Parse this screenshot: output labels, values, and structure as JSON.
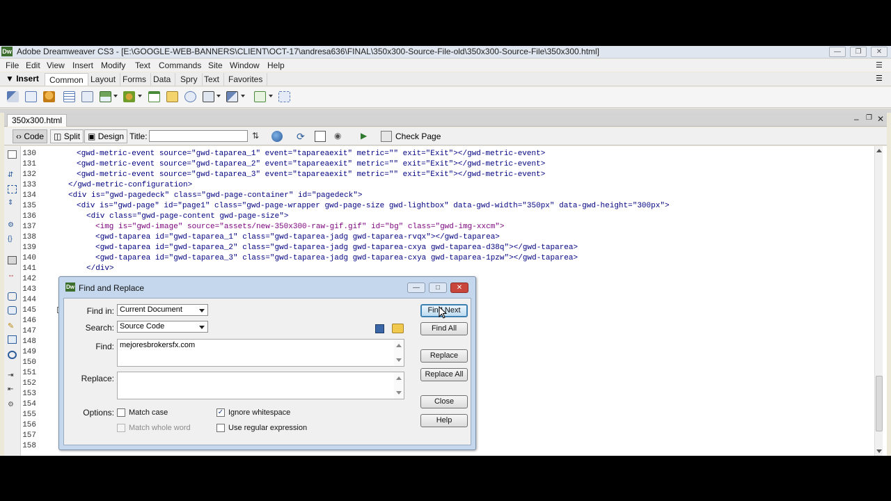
{
  "window": {
    "title": "Adobe Dreamweaver CS3 - [E:\\GOOGLE-WEB-BANNERS\\CLIENT\\OCT-17\\andresa636\\FINAL\\350x300-Source-File-old\\350x300-Source-File\\350x300.html]",
    "app_icon": "Dw",
    "controls": [
      "minimize",
      "restore",
      "close"
    ]
  },
  "menu": {
    "items": [
      "File",
      "Edit",
      "View",
      "Insert",
      "Modify",
      "Text",
      "Commands",
      "Site",
      "Window",
      "Help"
    ]
  },
  "insert_bar": {
    "label": "Insert",
    "tabs": [
      "Common",
      "Layout",
      "Forms",
      "Data",
      "Spry",
      "Text",
      "Favorites"
    ],
    "active_tab": "Common"
  },
  "document": {
    "tab_name": "350x300.html",
    "view_buttons": {
      "code": "Code",
      "split": "Split",
      "design": "Design"
    },
    "active_view": "Code",
    "title_label": "Title:",
    "title_value": "",
    "check_page_label": "Check Page"
  },
  "code": {
    "lines": [
      {
        "n": "130",
        "text": "<gwd-metric-event source=\"gwd-taparea_1\" event=\"tapareaexit\" metric=\"\" exit=\"Exit\"></gwd-metric-event>"
      },
      {
        "n": "131",
        "text": "<gwd-metric-event source=\"gwd-taparea_2\" event=\"tapareaexit\" metric=\"\" exit=\"Exit\"></gwd-metric-event>"
      },
      {
        "n": "132",
        "text": "<gwd-metric-event source=\"gwd-taparea_3\" event=\"tapareaexit\" metric=\"\" exit=\"Exit\"></gwd-metric-event>"
      },
      {
        "n": "133",
        "text": "</gwd-metric-configuration>"
      },
      {
        "n": "134",
        "text": "<div is=\"gwd-pagedeck\" class=\"gwd-page-container\" id=\"pagedeck\">"
      },
      {
        "n": "135",
        "text": "<div is=\"gwd-page\" id=\"page1\" class=\"gwd-page-wrapper gwd-page-size gwd-lightbox\" data-gwd-width=\"350px\" data-gwd-height=\"300px\">"
      },
      {
        "n": "136",
        "text": "<div class=\"gwd-page-content gwd-page-size\">"
      },
      {
        "n": "137",
        "text": "<img is=\"gwd-image\" source=\"assets/new-350x300-raw-gif.gif\" id=\"bg\" class=\"gwd-img-xxcm\">"
      },
      {
        "n": "138",
        "text": "<gwd-taparea id=\"gwd-taparea_1\" class=\"gwd-taparea-jadg gwd-taparea-rvqx\"></gwd-taparea>"
      },
      {
        "n": "139",
        "text": "<gwd-taparea id=\"gwd-taparea_2\" class=\"gwd-taparea-jadg gwd-taparea-cxya gwd-taparea-d38q\"></gwd-taparea>"
      },
      {
        "n": "140",
        "text": "<gwd-taparea id=\"gwd-taparea_3\" class=\"gwd-taparea-jadg gwd-taparea-cxya gwd-taparea-1pzw\"></gwd-taparea>"
      },
      {
        "n": "141",
        "text": "</div>"
      },
      {
        "n": "142",
        "text": ""
      },
      {
        "n": "143",
        "text": ""
      },
      {
        "n": "144",
        "text": ""
      },
      {
        "n": "145",
        "text": ""
      },
      {
        "n": "146",
        "text": ""
      },
      {
        "n": "147",
        "text": ""
      },
      {
        "n": "148",
        "text": ""
      },
      {
        "n": "149",
        "text": ""
      },
      {
        "n": "150",
        "text": ""
      },
      {
        "n": "151",
        "text": ""
      },
      {
        "n": "152",
        "text": ""
      },
      {
        "n": "153",
        "text": ""
      },
      {
        "n": "154",
        "text": ""
      },
      {
        "n": "155",
        "text": ""
      },
      {
        "n": "156",
        "text": ""
      },
      {
        "n": "157",
        "text": ""
      },
      {
        "n": "158",
        "text": ""
      }
    ]
  },
  "dialog": {
    "title": "Find and Replace",
    "find_in_label": "Find in:",
    "find_in_value": "Current Document",
    "search_label": "Search:",
    "search_value": "Source Code",
    "find_label": "Find:",
    "find_value": "mejoresbrokersfx.com",
    "replace_label": "Replace:",
    "replace_value": "",
    "options_label": "Options:",
    "match_case": {
      "label": "Match case",
      "checked": false,
      "enabled": true
    },
    "match_whole_word": {
      "label": "Match whole word",
      "checked": false,
      "enabled": false
    },
    "ignore_whitespace": {
      "label": "Ignore whitespace",
      "checked": true,
      "enabled": true
    },
    "use_regex": {
      "label": "Use regular expression",
      "checked": false,
      "enabled": true
    },
    "buttons": {
      "find_next": "Find Next",
      "find_all": "Find All",
      "replace": "Replace",
      "replace_all": "Replace All",
      "close": "Close",
      "help": "Help"
    }
  }
}
